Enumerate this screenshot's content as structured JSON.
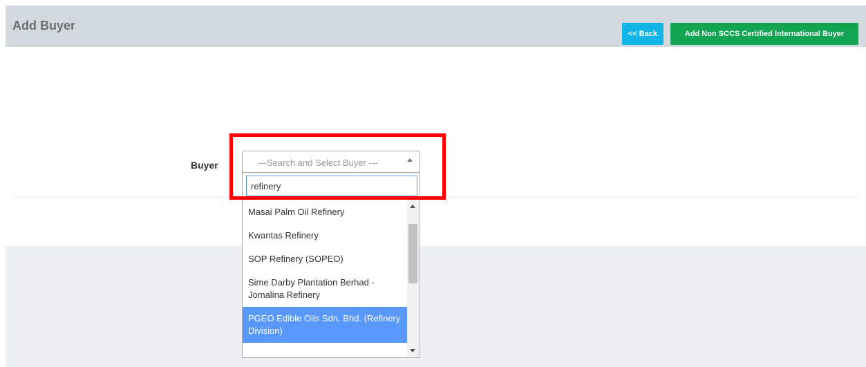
{
  "header": {
    "title": "Add Buyer",
    "back_label": "<< Back",
    "add_label": "Add Non SCCS Certified International Buyer"
  },
  "form": {
    "buyer_label": "Buyer",
    "select": {
      "placeholder": "---Search and Select Buyer ---",
      "search_value": "refinery"
    },
    "results": [
      "Masai Palm Oil Refinery",
      "Kwantas Refinery",
      "SOP Refinery (SOPEO)",
      "Sime Darby Plantation Berhad - Jomalina Refinery",
      "PGEO Edible Oils Sdn. Bhd. (Refinery Division)"
    ],
    "highlighted_index": 4
  },
  "colors": {
    "header_bg": "#d2dae0",
    "back_button": "#13b5e8",
    "add_button": "#11a551",
    "highlight": "#5897fb",
    "annotation": "#ff0000"
  }
}
